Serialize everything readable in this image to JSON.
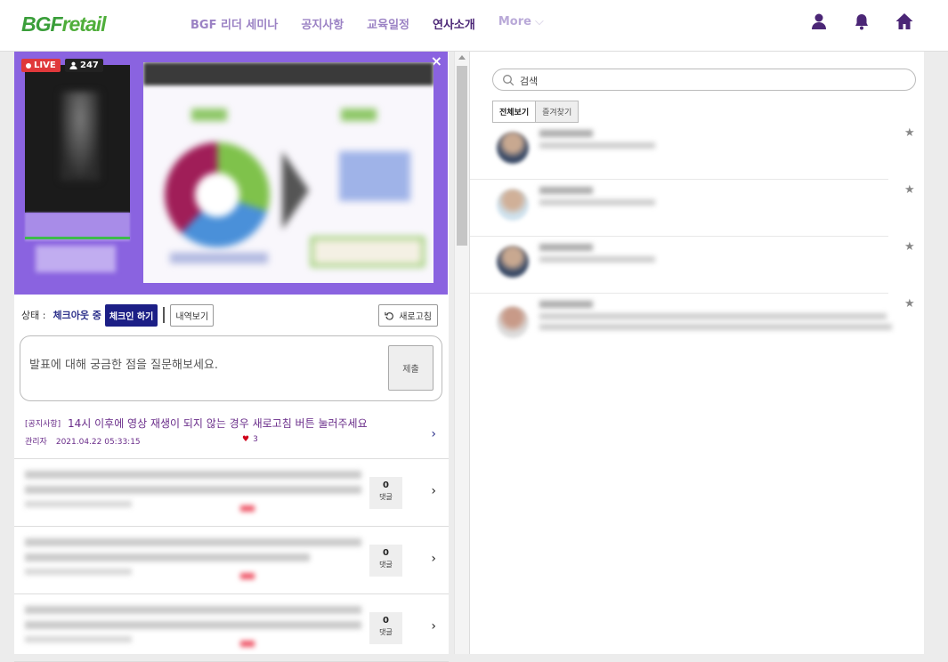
{
  "header": {
    "logo": {
      "part1": "BGF",
      "part2": "retail"
    },
    "nav": [
      "BGF 리더 세미나",
      "공지사항",
      "교육일정",
      "연사소개",
      "More"
    ],
    "active_nav": "연사소개",
    "icons": [
      "user-icon",
      "bell-icon",
      "home-icon"
    ]
  },
  "video": {
    "live_label": "LIVE",
    "viewer_count": "247",
    "close_glyph": "×"
  },
  "status": {
    "label": "상태 :",
    "value": "체크아웃 중",
    "checkin_button": "체크인 하기",
    "history_button": "내역보기",
    "refresh_button": "새로고침"
  },
  "question": {
    "placeholder": "발표에 대해 궁금한 점을 질문해보세요.",
    "submit": "제출"
  },
  "notice": {
    "tag": "[공지사항]",
    "title": "14시 이후에 영상 재생이 되지 않는 경우 새로고침 버튼 눌러주세요",
    "author": "관리자",
    "date": "2021.04.22 05:33:15",
    "likes": "3"
  },
  "questions": [
    {
      "comments": "0",
      "comment_label": "댓글"
    },
    {
      "comments": "0",
      "comment_label": "댓글"
    },
    {
      "comments": "0",
      "comment_label": "댓글"
    }
  ],
  "right_panel": {
    "search_placeholder": "검색",
    "tabs": [
      "전체보기",
      "즐겨찾기"
    ]
  },
  "colors": {
    "brand_purple": "#4b2676",
    "nav_purple": "#9b82c4",
    "live_red": "#e0383b",
    "video_bg": "#8a63e0",
    "checkin_navy": "#1c1f86",
    "logo_green": "#3a9e3a"
  }
}
